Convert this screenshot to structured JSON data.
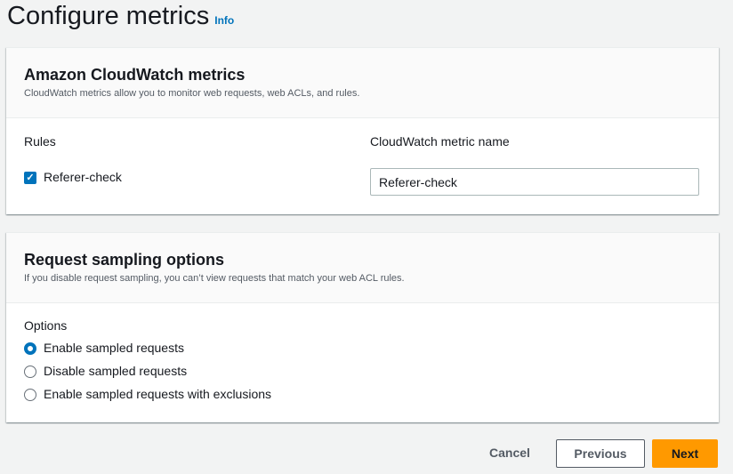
{
  "header": {
    "title": "Configure metrics",
    "info": "Info"
  },
  "cloudwatch": {
    "title": "Amazon CloudWatch metrics",
    "description": "CloudWatch metrics allow you to monitor web requests, web ACLs, and rules.",
    "rules_label": "Rules",
    "metric_name_label": "CloudWatch metric name",
    "rule": {
      "name": "Referer-check",
      "checked": true,
      "metric_name": "Referer-check"
    }
  },
  "sampling": {
    "title": "Request sampling options",
    "description": "If you disable request sampling, you can’t view requests that match your web ACL rules.",
    "options_label": "Options",
    "options": [
      {
        "label": "Enable sampled requests",
        "selected": true
      },
      {
        "label": "Disable sampled requests",
        "selected": false
      },
      {
        "label": "Enable sampled requests with exclusions",
        "selected": false
      }
    ]
  },
  "footer": {
    "cancel": "Cancel",
    "previous": "Previous",
    "next": "Next"
  },
  "colors": {
    "accent": "#0073bb",
    "primary_button": "#ff9900"
  }
}
